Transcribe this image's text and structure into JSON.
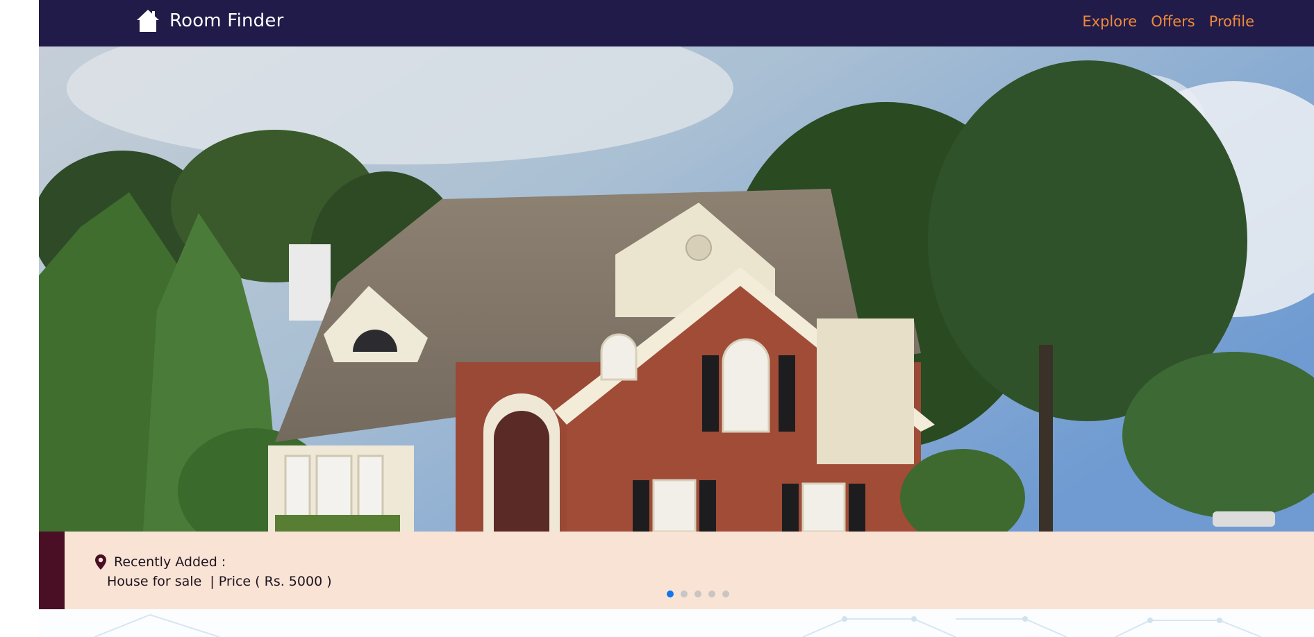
{
  "navbar": {
    "brand_label": "Room Finder",
    "brand_icon": "home-icon",
    "links": [
      {
        "label": "Explore"
      },
      {
        "label": "Offers"
      },
      {
        "label": "Profile"
      }
    ],
    "colors": {
      "background": "#211b4a",
      "link": "#f08a3a",
      "brand": "#ffffff"
    }
  },
  "carousel": {
    "image_subject": "two-story brick house with shingled roof surrounded by trees",
    "caption": {
      "icon": "map-pin-icon",
      "title": "Recently Added :",
      "description": "House for sale  | Price ( Rs. 5000 )"
    },
    "indicators": {
      "count": 5,
      "active_index": 0
    },
    "colors": {
      "caption_background": "#f8e3d5",
      "caption_accent": "#4a0f24",
      "indicator_active": "#1177ee",
      "indicator_inactive": "#c9c5c4"
    }
  }
}
